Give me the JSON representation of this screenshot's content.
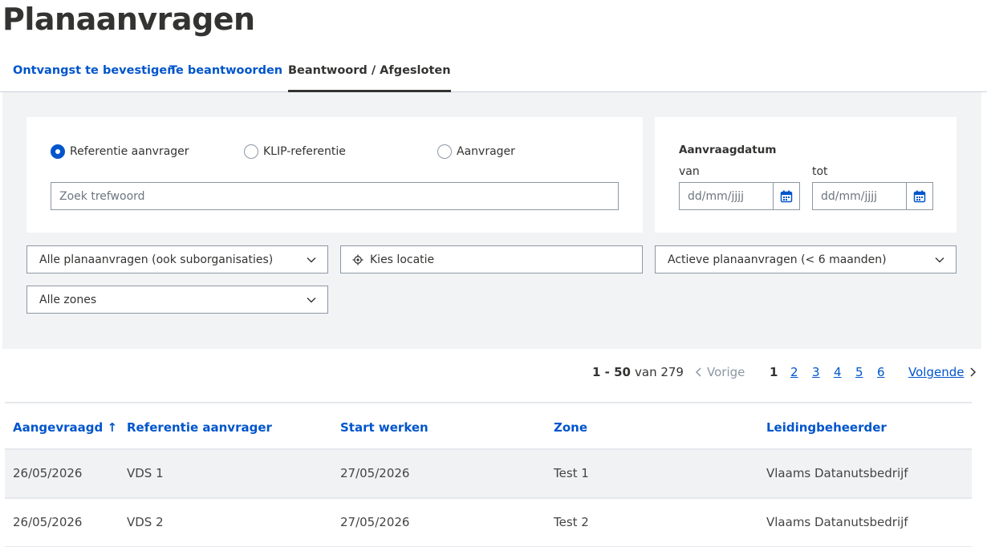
{
  "page": {
    "title": "Planaanvragen"
  },
  "tabs": [
    {
      "label": "Ontvangst te bevestigen"
    },
    {
      "label": "Te beantwoorden"
    },
    {
      "label": "Beantwoord / Afgesloten",
      "active": true
    }
  ],
  "search": {
    "radios": [
      {
        "label": "Referentie aanvrager",
        "checked": true
      },
      {
        "label": "KLIP-referentie",
        "checked": false
      },
      {
        "label": "Aanvrager",
        "checked": false
      }
    ],
    "placeholder": "Zoek trefwoord"
  },
  "date_filter": {
    "label": "Aanvraagdatum",
    "from_label": "van",
    "to_label": "tot",
    "from_placeholder": "dd/mm/jjjj",
    "to_placeholder": "dd/mm/jjjj"
  },
  "filters": {
    "organisation": "Alle planaanvragen (ook suborganisaties)",
    "location": "Kies locatie",
    "period": "Actieve planaanvragen (< 6 maanden)",
    "zones": "Alle zones"
  },
  "pagination": {
    "range": "1 - 50",
    "total_text": "van 279",
    "prev": "Vorige",
    "pages": [
      "1",
      "2",
      "3",
      "4",
      "5",
      "6"
    ],
    "current": "1",
    "next": "Volgende"
  },
  "table": {
    "headers": [
      "Aangevraagd",
      "Referentie aanvrager",
      "Start werken",
      "Zone",
      "Leidingbeheerder"
    ],
    "sort_indicator": "↑",
    "rows": [
      [
        "26/05/2026",
        "VDS 1",
        "27/05/2026",
        "Test 1",
        "Vlaams Datanutsbedrijf"
      ],
      [
        "26/05/2026",
        "VDS 2",
        "27/05/2026",
        "Test 2",
        "Vlaams Datanutsbedrijf"
      ]
    ]
  },
  "colors": {
    "accent": "#0055cc",
    "text": "#333332",
    "filter_bg": "#f1f3f5",
    "row_alt": "#f1f2f4"
  },
  "icons": [
    "calendar-icon",
    "chevron-down-icon",
    "location-pin-icon",
    "chevron-left-icon",
    "chevron-right-icon",
    "sort-up-icon"
  ]
}
